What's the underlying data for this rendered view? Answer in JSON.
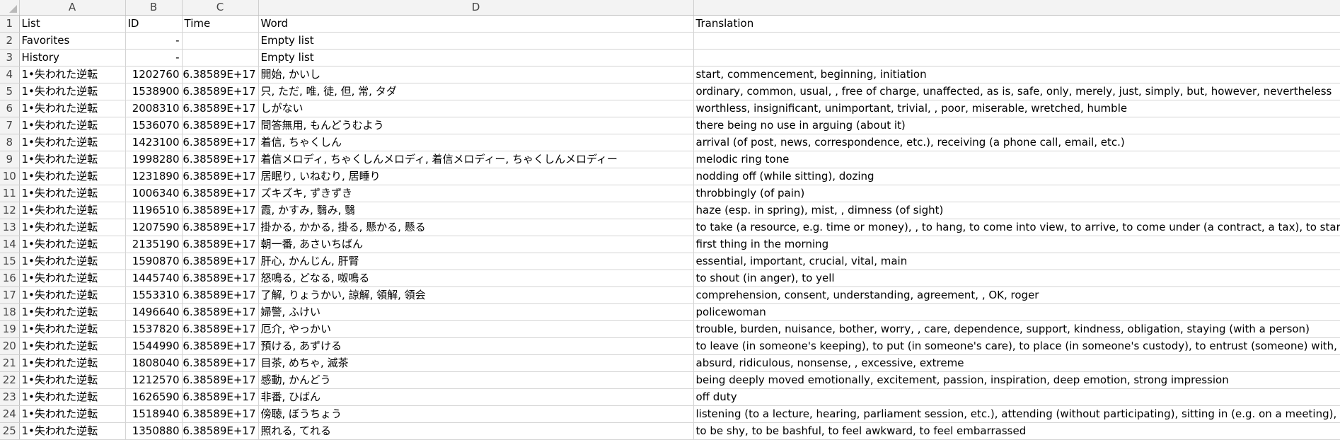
{
  "columns": {
    "letters": [
      "A",
      "B",
      "C",
      "D",
      ""
    ]
  },
  "header_row": {
    "number": "1",
    "list": "List",
    "id": "ID",
    "time": "Time",
    "word": "Word",
    "translation": "Translation"
  },
  "rows": [
    {
      "n": "2",
      "list": "Favorites",
      "id": "-",
      "time": "",
      "word": "Empty list",
      "translation": ""
    },
    {
      "n": "3",
      "list": "History",
      "id": "-",
      "time": "",
      "word": "Empty list",
      "translation": ""
    },
    {
      "n": "4",
      "list": "1•失われた逆転",
      "id": "1202760",
      "time": "6.38589E+17",
      "word": "開始, かいし",
      "translation": "start, commencement, beginning, initiation"
    },
    {
      "n": "5",
      "list": "1•失われた逆転",
      "id": "1538900",
      "time": "6.38589E+17",
      "word": "只, ただ, 唯, 徒, 但, 常, タダ",
      "translation": "ordinary, common, usual, , free of charge, unaffected, as is, safe, only, merely, just, simply, but, however, nevertheless"
    },
    {
      "n": "6",
      "list": "1•失われた逆転",
      "id": "2008310",
      "time": "6.38589E+17",
      "word": "しがない",
      "translation": "worthless, insignificant, unimportant, trivial, , poor, miserable, wretched, humble"
    },
    {
      "n": "7",
      "list": "1•失われた逆転",
      "id": "1536070",
      "time": "6.38589E+17",
      "word": "問答無用, もんどうむよう",
      "translation": "there being no use in arguing (about it)"
    },
    {
      "n": "8",
      "list": "1•失われた逆転",
      "id": "1423100",
      "time": "6.38589E+17",
      "word": "着信, ちゃくしん",
      "translation": "arrival (of post, news, correspondence, etc.), receiving (a phone call, email, etc.)"
    },
    {
      "n": "9",
      "list": "1•失われた逆転",
      "id": "1998280",
      "time": "6.38589E+17",
      "word": "着信メロディ, ちゃくしんメロディ, 着信メロディー, ちゃくしんメロディー",
      "translation": "melodic ring tone"
    },
    {
      "n": "10",
      "list": "1•失われた逆転",
      "id": "1231890",
      "time": "6.38589E+17",
      "word": "居眠り, いねむり, 居睡り",
      "translation": "nodding off (while sitting), dozing"
    },
    {
      "n": "11",
      "list": "1•失われた逆転",
      "id": "1006340",
      "time": "6.38589E+17",
      "word": "ズキズキ, ずきずき",
      "translation": "throbbingly (of pain)"
    },
    {
      "n": "12",
      "list": "1•失われた逆転",
      "id": "1196510",
      "time": "6.38589E+17",
      "word": "霞, かすみ, 翳み, 翳",
      "translation": "haze (esp. in spring), mist, , dimness (of sight)"
    },
    {
      "n": "13",
      "list": "1•失われた逆転",
      "id": "1207590",
      "time": "6.38589E+17",
      "word": "掛かる, かかる, 掛る, 懸かる, 懸る",
      "translation": "to take (a resource, e.g. time or money), , to hang, to come into view, to arrive, to come under (a contract, a tax), to start (engines,"
    },
    {
      "n": "14",
      "list": "1•失われた逆転",
      "id": "2135190",
      "time": "6.38589E+17",
      "word": "朝一番, あさいちばん",
      "translation": "first thing in the morning"
    },
    {
      "n": "15",
      "list": "1•失われた逆転",
      "id": "1590870",
      "time": "6.38589E+17",
      "word": "肝心, かんじん, 肝腎",
      "translation": "essential, important, crucial, vital, main"
    },
    {
      "n": "16",
      "list": "1•失われた逆転",
      "id": "1445740",
      "time": "6.38589E+17",
      "word": "怒鳴る, どなる, 呶鳴る",
      "translation": "to shout (in anger), to yell"
    },
    {
      "n": "17",
      "list": "1•失われた逆転",
      "id": "1553310",
      "time": "6.38589E+17",
      "word": "了解, りょうかい, 諒解, 領解, 領会",
      "translation": "comprehension, consent, understanding, agreement, , OK, roger"
    },
    {
      "n": "18",
      "list": "1•失われた逆転",
      "id": "1496640",
      "time": "6.38589E+17",
      "word": "婦警, ふけい",
      "translation": "policewoman"
    },
    {
      "n": "19",
      "list": "1•失われた逆転",
      "id": "1537820",
      "time": "6.38589E+17",
      "word": "厄介, やっかい",
      "translation": "trouble, burden, nuisance, bother, worry, , care, dependence, support, kindness, obligation, staying (with a person)"
    },
    {
      "n": "20",
      "list": "1•失われた逆転",
      "id": "1544990",
      "time": "6.38589E+17",
      "word": "預ける, あずける",
      "translation": "to leave (in someone's keeping), to put (in someone's care), to place (in someone's custody), to entrust (someone) with, to deposit"
    },
    {
      "n": "21",
      "list": "1•失われた逆転",
      "id": "1808040",
      "time": "6.38589E+17",
      "word": "目茶, めちゃ, 滅茶",
      "translation": "absurd, ridiculous, nonsense, , excessive, extreme"
    },
    {
      "n": "22",
      "list": "1•失われた逆転",
      "id": "1212570",
      "time": "6.38589E+17",
      "word": "感動, かんどう",
      "translation": "being deeply moved emotionally, excitement, passion, inspiration, deep emotion, strong impression"
    },
    {
      "n": "23",
      "list": "1•失われた逆転",
      "id": "1626590",
      "time": "6.38589E+17",
      "word": "非番, ひばん",
      "translation": "off duty"
    },
    {
      "n": "24",
      "list": "1•失われた逆転",
      "id": "1518940",
      "time": "6.38589E+17",
      "word": "傍聴, ぼうちょう",
      "translation": "listening (to a lecture, hearing, parliament session, etc.), attending (without participating), sitting in (e.g. on a meeting), observing"
    },
    {
      "n": "25",
      "list": "1•失われた逆転",
      "id": "1350880",
      "time": "6.38589E+17",
      "word": "照れる, てれる",
      "translation": "to be shy, to be bashful, to feel awkward, to feel embarrassed"
    }
  ]
}
